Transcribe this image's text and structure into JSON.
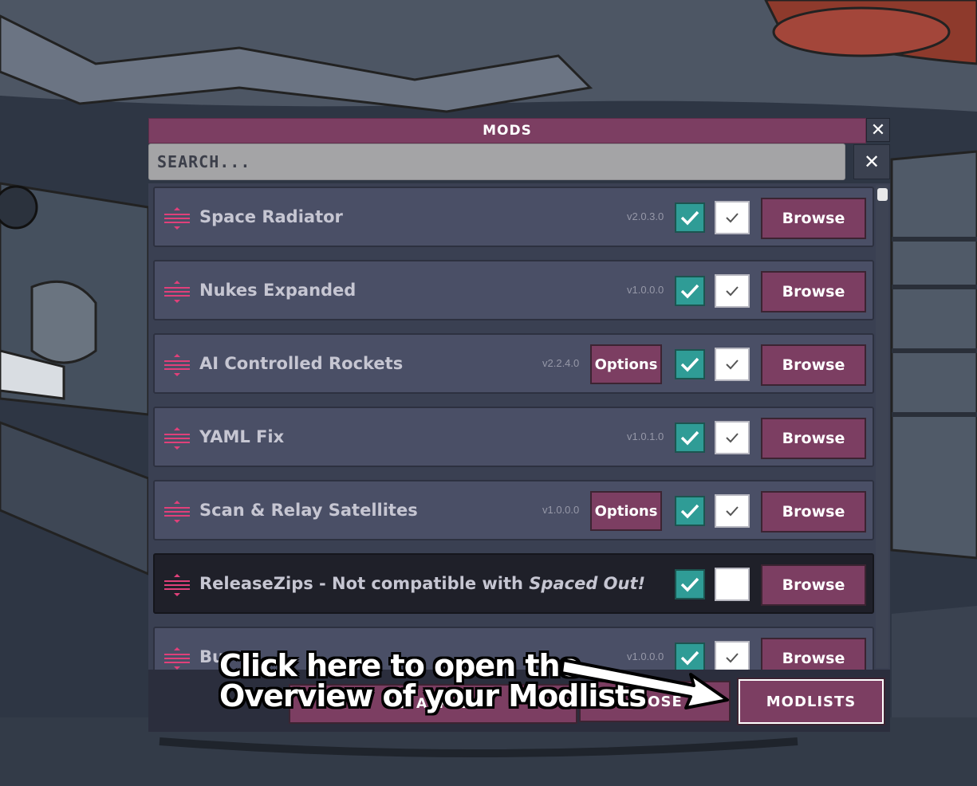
{
  "window": {
    "title": "MODS",
    "close_glyph": "✕"
  },
  "search": {
    "placeholder": "SEARCH...",
    "value": "",
    "clear_glyph": "✕"
  },
  "mods": [
    {
      "title": "Space Radiator",
      "version": "v2.0.3.0",
      "options": "",
      "enabled": true,
      "compatible": true,
      "browse": "Browse"
    },
    {
      "title": "Nukes Expanded",
      "version": "v1.0.0.0",
      "options": "",
      "enabled": true,
      "compatible": true,
      "browse": "Browse"
    },
    {
      "title": "AI Controlled Rockets",
      "version": "v2.2.4.0",
      "options": "Options",
      "enabled": true,
      "compatible": true,
      "browse": "Browse"
    },
    {
      "title": "YAML Fix",
      "version": "v1.0.1.0",
      "options": "",
      "enabled": true,
      "compatible": true,
      "browse": "Browse"
    },
    {
      "title": "Scan & Relay Satellites",
      "version": "v1.0.0.0",
      "options": "Options",
      "enabled": true,
      "compatible": true,
      "browse": "Browse"
    },
    {
      "title": "ReleaseZips - Not compatible with ",
      "title_em": "Spaced Out!",
      "version": "",
      "options": "",
      "enabled": true,
      "compatible": false,
      "browse": "Browse"
    },
    {
      "title": "Bu",
      "version": "v1.0.0.0",
      "options": "",
      "enabled": true,
      "compatible": true,
      "browse": "Browse"
    }
  ],
  "bottom": {
    "hidden_button_fragments": "D          ACK   N",
    "close_label": "CLOSE",
    "modlists_label": "MODLISTS"
  },
  "annotation": {
    "line1": "Click here to open the",
    "line2": "Overview of your Modlists"
  },
  "icons": {
    "drag": "drag-handle-icon",
    "check": "checkmark-icon",
    "close": "close-icon",
    "arrow": "arrow-right-icon"
  },
  "colors": {
    "accent": "#7c3e62",
    "teal": "#2f9c96",
    "row": "#4a4f66",
    "row_incompatible": "#1f2029"
  }
}
